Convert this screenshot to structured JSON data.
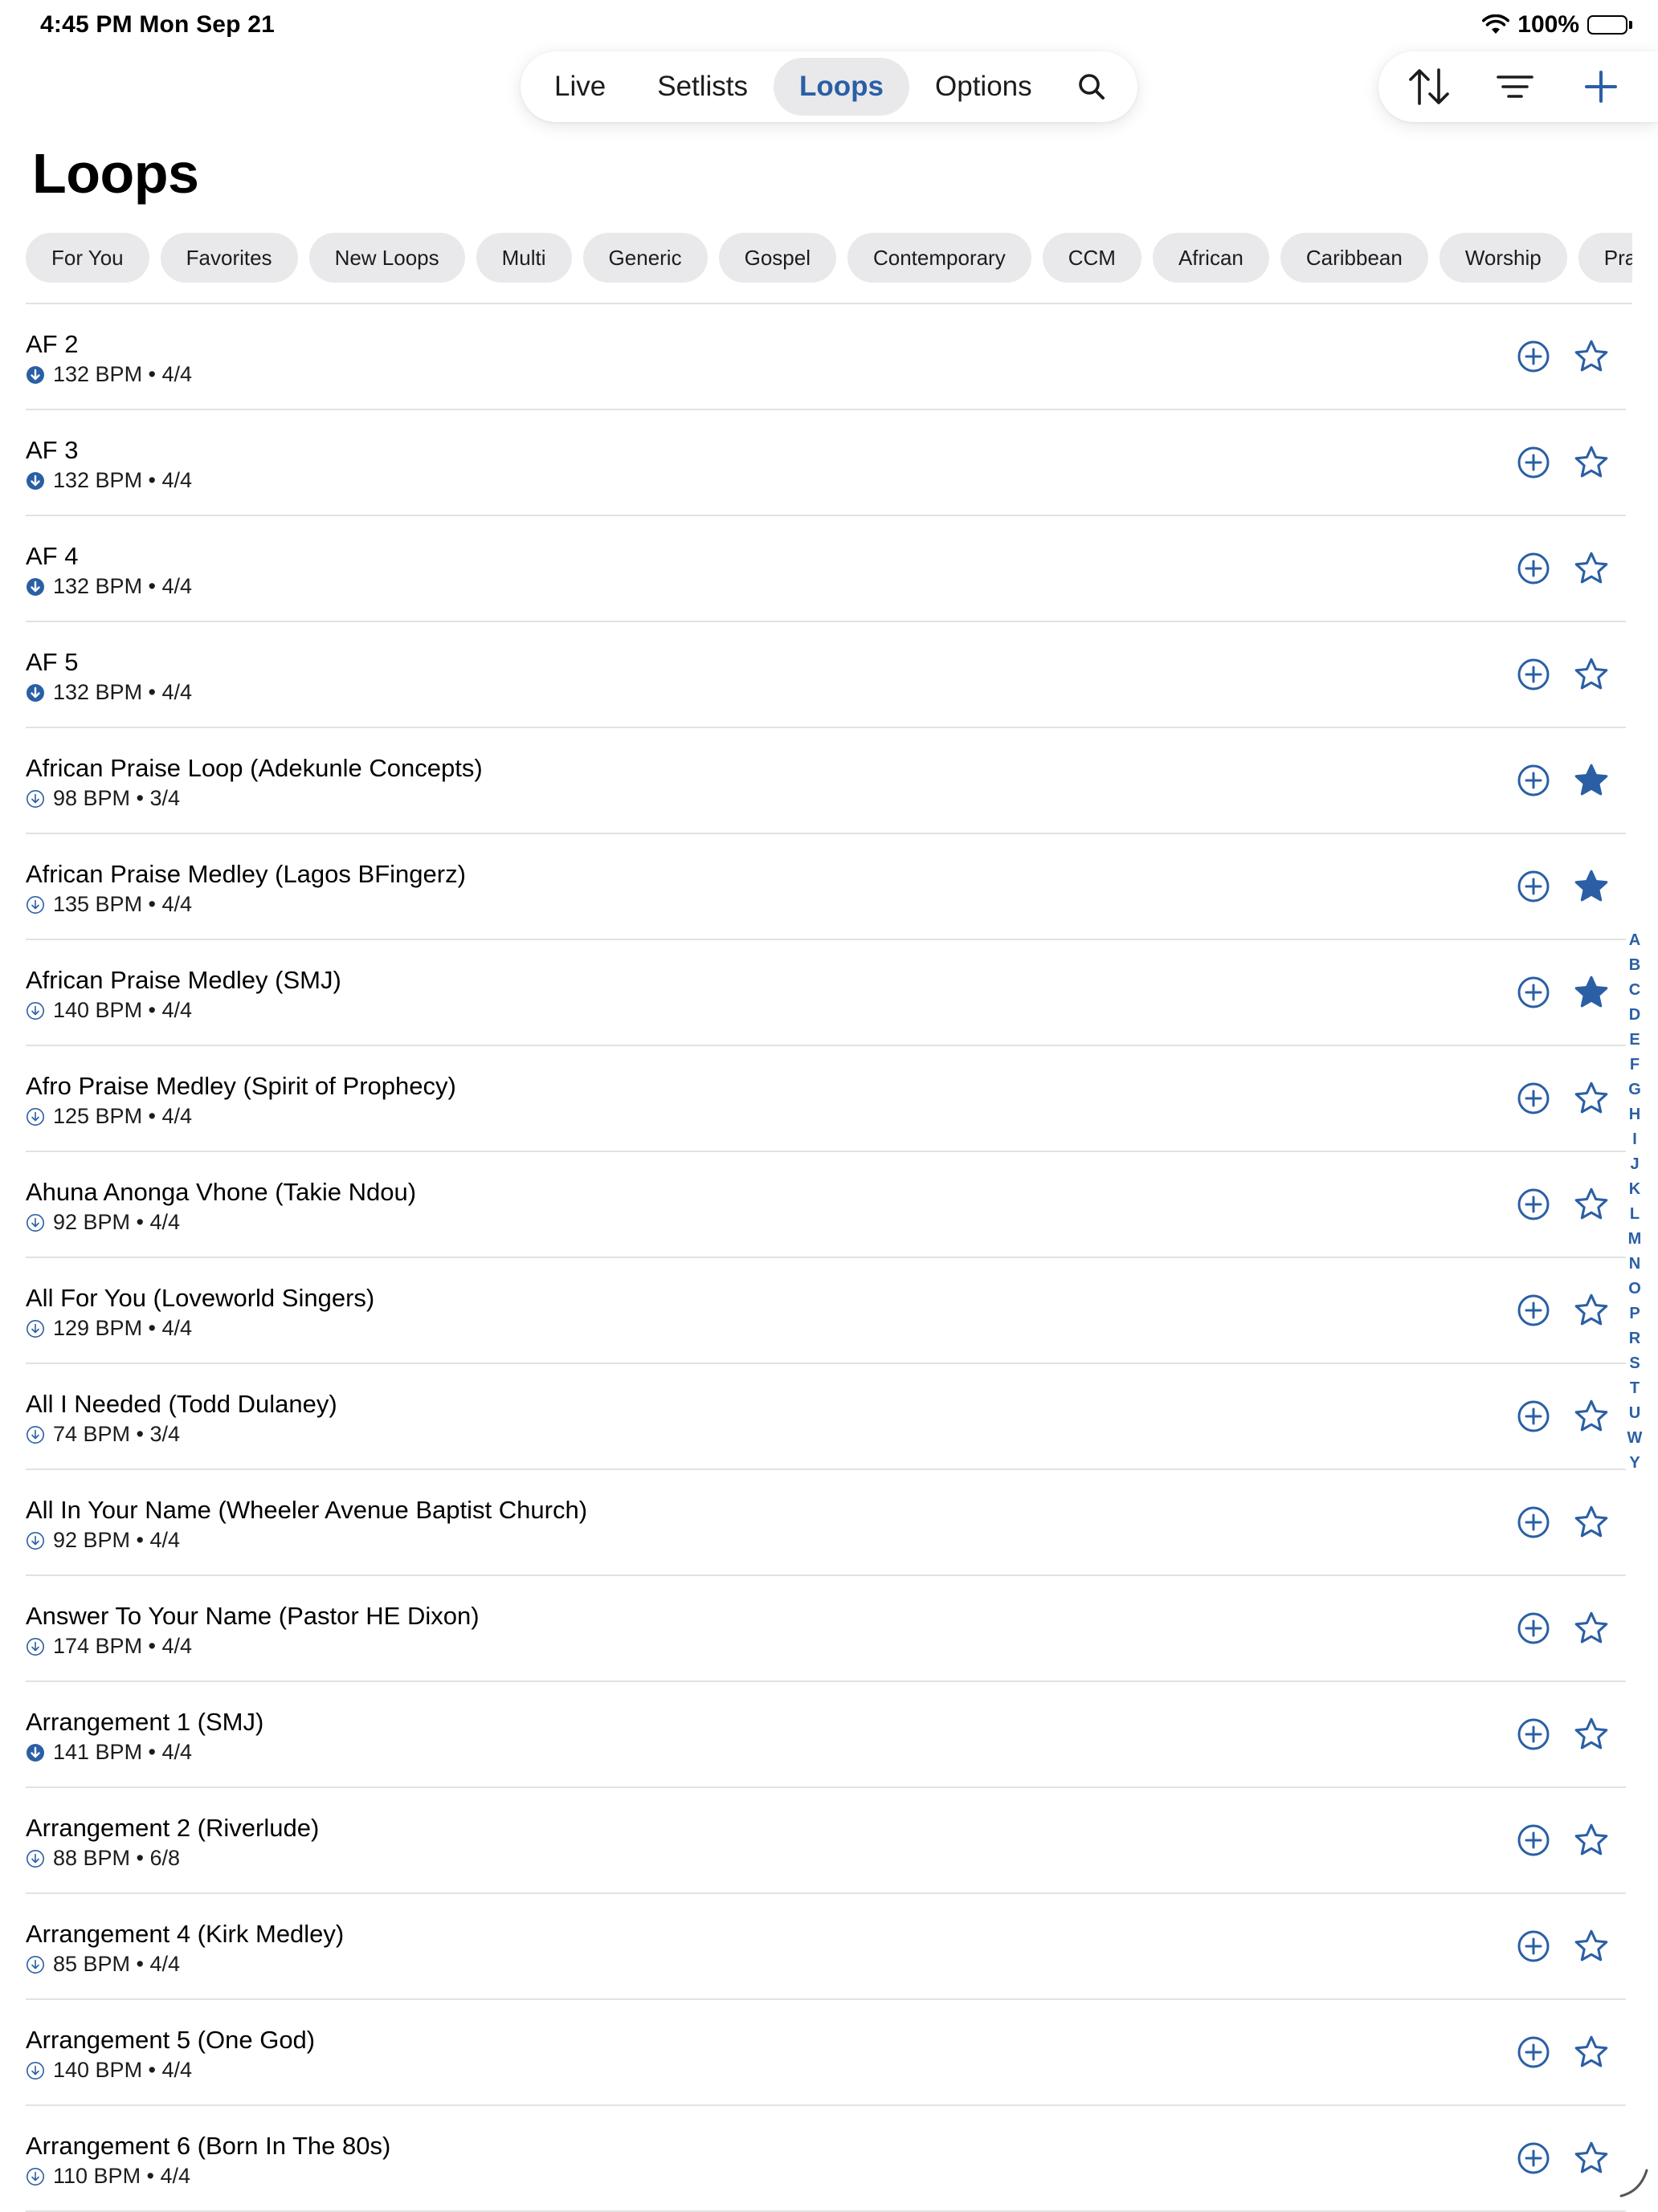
{
  "status_bar": {
    "time": "4:45 PM   Mon Sep 21",
    "battery": "100%"
  },
  "nav": {
    "tabs": [
      {
        "label": "Live",
        "active": false
      },
      {
        "label": "Setlists",
        "active": false
      },
      {
        "label": "Loops",
        "active": true
      },
      {
        "label": "Options",
        "active": false
      }
    ],
    "search_icon": "search-icon"
  },
  "toolbar": {
    "sort_icon": "sort-icon",
    "filter_icon": "filter-icon",
    "add_icon": "plus-icon"
  },
  "page": {
    "title": "Loops"
  },
  "colors": {
    "accent": "#2a5fa5",
    "chip_bg": "#e9e9eb",
    "divider": "#e2e2e4"
  },
  "chips": [
    "For You",
    "Favorites",
    "New Loops",
    "Multi",
    "Generic",
    "Gospel",
    "Contemporary",
    "CCM",
    "African",
    "Caribbean",
    "Worship",
    "Praise"
  ],
  "loops": [
    {
      "title": "AF 2",
      "meta": "132 BPM • 4/4",
      "downloaded": true,
      "favorite": false
    },
    {
      "title": "AF 3",
      "meta": "132 BPM • 4/4",
      "downloaded": true,
      "favorite": false
    },
    {
      "title": "AF 4",
      "meta": "132 BPM • 4/4",
      "downloaded": true,
      "favorite": false
    },
    {
      "title": "AF 5",
      "meta": "132 BPM • 4/4",
      "downloaded": true,
      "favorite": false
    },
    {
      "title": "African Praise Loop (Adekunle Concepts)",
      "meta": "98 BPM • 3/4",
      "downloaded": false,
      "favorite": true
    },
    {
      "title": "African Praise Medley (Lagos BFingerz)",
      "meta": "135 BPM • 4/4",
      "downloaded": false,
      "favorite": true
    },
    {
      "title": "African Praise Medley (SMJ)",
      "meta": "140 BPM • 4/4",
      "downloaded": false,
      "favorite": true
    },
    {
      "title": "Afro Praise Medley (Spirit of Prophecy)",
      "meta": "125 BPM • 4/4",
      "downloaded": false,
      "favorite": false
    },
    {
      "title": "Ahuna Anonga Vhone (Takie Ndou)",
      "meta": "92 BPM • 4/4",
      "downloaded": false,
      "favorite": false
    },
    {
      "title": "All For You (Loveworld Singers)",
      "meta": "129 BPM • 4/4",
      "downloaded": false,
      "favorite": false
    },
    {
      "title": "All I Needed (Todd Dulaney)",
      "meta": "74 BPM • 3/4",
      "downloaded": false,
      "favorite": false
    },
    {
      "title": "All In Your Name (Wheeler Avenue Baptist Church)",
      "meta": "92 BPM • 4/4",
      "downloaded": false,
      "favorite": false
    },
    {
      "title": "Answer To Your Name (Pastor HE Dixon)",
      "meta": "174 BPM • 4/4",
      "downloaded": false,
      "favorite": false
    },
    {
      "title": "Arrangement 1 (SMJ)",
      "meta": "141 BPM • 4/4",
      "downloaded": true,
      "favorite": false
    },
    {
      "title": "Arrangement 2 (Riverlude)",
      "meta": "88 BPM • 6/8",
      "downloaded": false,
      "favorite": false
    },
    {
      "title": "Arrangement 4 (Kirk Medley)",
      "meta": "85 BPM • 4/4",
      "downloaded": false,
      "favorite": false
    },
    {
      "title": "Arrangement 5 (One God)",
      "meta": "140 BPM • 4/4",
      "downloaded": false,
      "favorite": false
    },
    {
      "title": "Arrangement 6 (Born In The 80s)",
      "meta": "110 BPM • 4/4",
      "downloaded": false,
      "favorite": false
    }
  ],
  "alphabet": [
    "A",
    "B",
    "C",
    "D",
    "E",
    "F",
    "G",
    "H",
    "I",
    "J",
    "K",
    "L",
    "M",
    "N",
    "O",
    "P",
    "R",
    "S",
    "T",
    "U",
    "W",
    "Y"
  ]
}
